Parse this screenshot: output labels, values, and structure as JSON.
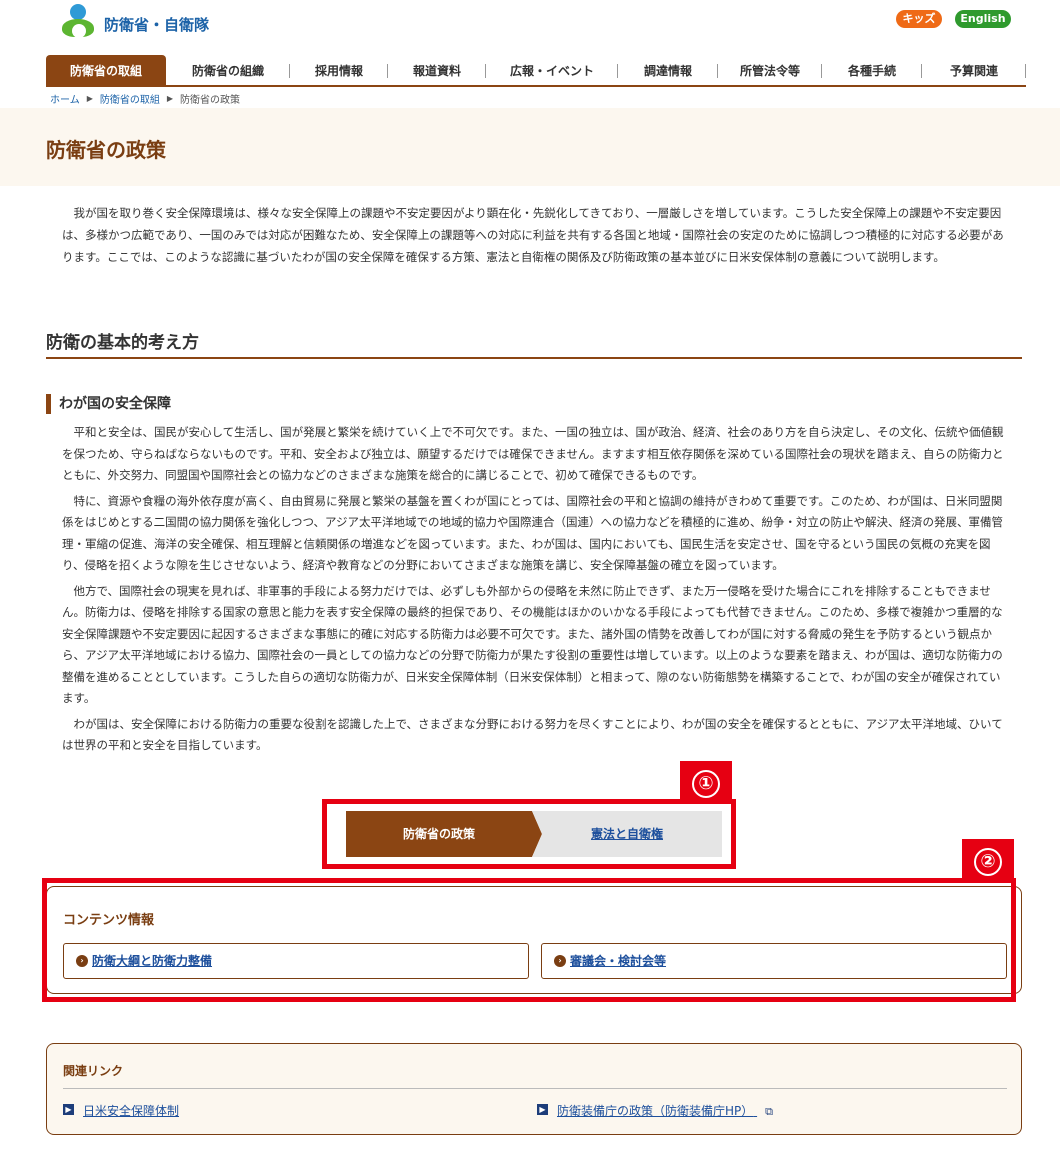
{
  "header": {
    "logo_text": "防衛省・自衛隊",
    "kids_label": "キッズ",
    "english_label": "English"
  },
  "gnav": [
    {
      "label": "防衛省の取組",
      "active": true
    },
    {
      "label": "防衛省の組織"
    },
    {
      "label": "採用情報"
    },
    {
      "label": "報道資料"
    },
    {
      "label": "広報・イベント"
    },
    {
      "label": "調達情報"
    },
    {
      "label": "所管法令等"
    },
    {
      "label": "各種手続"
    },
    {
      "label": "予算関連"
    }
  ],
  "breadcrumb": {
    "home": "ホーム",
    "parent": "防衛省の取組",
    "current": "防衛省の政策"
  },
  "page_title": "防衛省の政策",
  "lead": "我が国を取り巻く安全保障環境は、様々な安全保障上の課題や不安定要因がより顕在化・先鋭化してきており、一層厳しさを増しています。こうした安全保障上の課題や不安定要因は、多様かつ広範であり、一国のみでは対応が困難なため、安全保障上の課題等への対応に利益を共有する各国と地域・国際社会の安定のために協調しつつ積極的に対応する必要があります。ここでは、このような認識に基づいたわが国の安全保障を確保する方策、憲法と自衛権の関係及び防衛政策の基本並びに日米安保体制の意義について説明します。",
  "section": {
    "h2": "防衛の基本的考え方",
    "h3": "わが国の安全保障",
    "paragraphs": [
      "平和と安全は、国民が安心して生活し、国が発展と繁栄を続けていく上で不可欠です。また、一国の独立は、国が政治、経済、社会のあり方を自ら決定し、その文化、伝統や価値観を保つため、守らねばならないものです。平和、安全および独立は、願望するだけでは確保できません。ますます相互依存関係を深めている国際社会の現状を踏まえ、自らの防衛力とともに、外交努力、同盟国や国際社会との協力などのさまざまな施策を総合的に講じることで、初めて確保できるものです。",
      "特に、資源や食糧の海外依存度が高く、自由貿易に発展と繁栄の基盤を置くわが国にとっては、国際社会の平和と協調の維持がきわめて重要です。このため、わが国は、日米同盟関係をはじめとする二国間の協力関係を強化しつつ、アジア太平洋地域での地域的協力や国際連合（国連）への協力などを積極的に進め、紛争・対立の防止や解決、経済の発展、軍備管理・軍縮の促進、海洋の安全確保、相互理解と信頼関係の増進などを図っています。また、わが国は、国内においても、国民生活を安定させ、国を守るという国民の気概の充実を図り、侵略を招くような隙を生じさせないよう、経済や教育などの分野においてさまざまな施策を講じ、安全保障基盤の確立を図っています。",
      "他方で、国際社会の現実を見れば、非軍事的手段による努力だけでは、必ずしも外部からの侵略を未然に防止できず、また万一侵略を受けた場合にこれを排除することもできません。防衛力は、侵略を排除する国家の意思と能力を表す安全保障の最終的担保であり、その機能はほかのいかなる手段によっても代替できません。このため、多様で複雑かつ重層的な安全保障課題や不安定要因に起因するさまざまな事態に的確に対応する防衛力は必要不可欠です。また、諸外国の情勢を改善してわが国に対する脅威の発生を予防するという観点から、アジア太平洋地域における協力、国際社会の一員としての協力などの分野で防衛力が果たす役割の重要性は増しています。以上のような要素を踏まえ、わが国は、適切な防衛力の整備を進めることとしています。こうした自らの適切な防衛力が、日米安全保障体制（日米安保体制）と相まって、隙のない防衛態勢を構築することで、わが国の安全が確保されています。",
      "わが国は、安全保障における防衛力の重要な役割を認識した上で、さまざまな分野における努力を尽くすことにより、わが国の安全を確保するとともに、アジア太平洋地域、ひいては世界の平和と安全を目指しています。"
    ]
  },
  "markers": {
    "one": "①",
    "two": "②"
  },
  "stepnav": {
    "current": "防衛省の政策",
    "next": "憲法と自衛権"
  },
  "contents": {
    "title": "コンテンツ情報",
    "items": [
      "防衛大綱と防衛力整備",
      "審議会・検討会等"
    ]
  },
  "related": {
    "title": "関連リンク",
    "links": [
      "日米安全保障体制",
      "防衛装備庁の政策（防衛装備庁HP）"
    ]
  },
  "colors": {
    "accent": "#8b4513",
    "annotation": "#e60012",
    "link": "#1d4f9c"
  }
}
